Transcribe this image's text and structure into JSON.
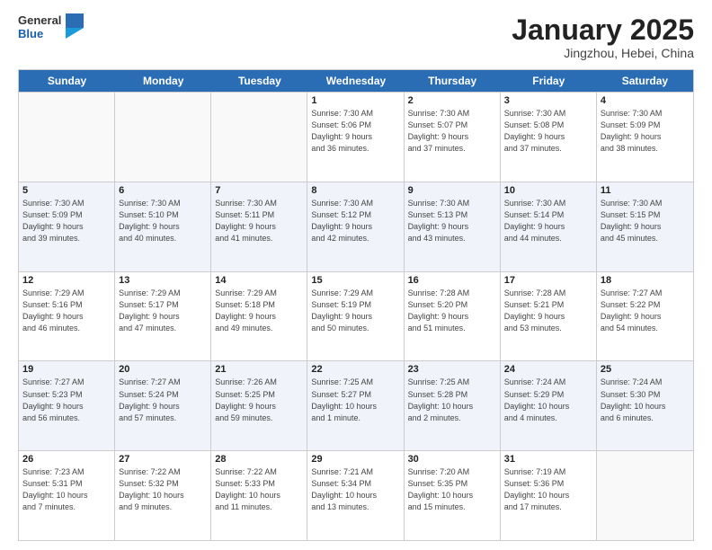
{
  "header": {
    "logo_general": "General",
    "logo_blue": "Blue",
    "month_year": "January 2025",
    "location": "Jingzhou, Hebei, China"
  },
  "days_of_week": [
    "Sunday",
    "Monday",
    "Tuesday",
    "Wednesday",
    "Thursday",
    "Friday",
    "Saturday"
  ],
  "weeks": [
    [
      {
        "day": "",
        "info": ""
      },
      {
        "day": "",
        "info": ""
      },
      {
        "day": "",
        "info": ""
      },
      {
        "day": "1",
        "info": "Sunrise: 7:30 AM\nSunset: 5:06 PM\nDaylight: 9 hours\nand 36 minutes."
      },
      {
        "day": "2",
        "info": "Sunrise: 7:30 AM\nSunset: 5:07 PM\nDaylight: 9 hours\nand 37 minutes."
      },
      {
        "day": "3",
        "info": "Sunrise: 7:30 AM\nSunset: 5:08 PM\nDaylight: 9 hours\nand 37 minutes."
      },
      {
        "day": "4",
        "info": "Sunrise: 7:30 AM\nSunset: 5:09 PM\nDaylight: 9 hours\nand 38 minutes."
      }
    ],
    [
      {
        "day": "5",
        "info": "Sunrise: 7:30 AM\nSunset: 5:09 PM\nDaylight: 9 hours\nand 39 minutes."
      },
      {
        "day": "6",
        "info": "Sunrise: 7:30 AM\nSunset: 5:10 PM\nDaylight: 9 hours\nand 40 minutes."
      },
      {
        "day": "7",
        "info": "Sunrise: 7:30 AM\nSunset: 5:11 PM\nDaylight: 9 hours\nand 41 minutes."
      },
      {
        "day": "8",
        "info": "Sunrise: 7:30 AM\nSunset: 5:12 PM\nDaylight: 9 hours\nand 42 minutes."
      },
      {
        "day": "9",
        "info": "Sunrise: 7:30 AM\nSunset: 5:13 PM\nDaylight: 9 hours\nand 43 minutes."
      },
      {
        "day": "10",
        "info": "Sunrise: 7:30 AM\nSunset: 5:14 PM\nDaylight: 9 hours\nand 44 minutes."
      },
      {
        "day": "11",
        "info": "Sunrise: 7:30 AM\nSunset: 5:15 PM\nDaylight: 9 hours\nand 45 minutes."
      }
    ],
    [
      {
        "day": "12",
        "info": "Sunrise: 7:29 AM\nSunset: 5:16 PM\nDaylight: 9 hours\nand 46 minutes."
      },
      {
        "day": "13",
        "info": "Sunrise: 7:29 AM\nSunset: 5:17 PM\nDaylight: 9 hours\nand 47 minutes."
      },
      {
        "day": "14",
        "info": "Sunrise: 7:29 AM\nSunset: 5:18 PM\nDaylight: 9 hours\nand 49 minutes."
      },
      {
        "day": "15",
        "info": "Sunrise: 7:29 AM\nSunset: 5:19 PM\nDaylight: 9 hours\nand 50 minutes."
      },
      {
        "day": "16",
        "info": "Sunrise: 7:28 AM\nSunset: 5:20 PM\nDaylight: 9 hours\nand 51 minutes."
      },
      {
        "day": "17",
        "info": "Sunrise: 7:28 AM\nSunset: 5:21 PM\nDaylight: 9 hours\nand 53 minutes."
      },
      {
        "day": "18",
        "info": "Sunrise: 7:27 AM\nSunset: 5:22 PM\nDaylight: 9 hours\nand 54 minutes."
      }
    ],
    [
      {
        "day": "19",
        "info": "Sunrise: 7:27 AM\nSunset: 5:23 PM\nDaylight: 9 hours\nand 56 minutes."
      },
      {
        "day": "20",
        "info": "Sunrise: 7:27 AM\nSunset: 5:24 PM\nDaylight: 9 hours\nand 57 minutes."
      },
      {
        "day": "21",
        "info": "Sunrise: 7:26 AM\nSunset: 5:25 PM\nDaylight: 9 hours\nand 59 minutes."
      },
      {
        "day": "22",
        "info": "Sunrise: 7:25 AM\nSunset: 5:27 PM\nDaylight: 10 hours\nand 1 minute."
      },
      {
        "day": "23",
        "info": "Sunrise: 7:25 AM\nSunset: 5:28 PM\nDaylight: 10 hours\nand 2 minutes."
      },
      {
        "day": "24",
        "info": "Sunrise: 7:24 AM\nSunset: 5:29 PM\nDaylight: 10 hours\nand 4 minutes."
      },
      {
        "day": "25",
        "info": "Sunrise: 7:24 AM\nSunset: 5:30 PM\nDaylight: 10 hours\nand 6 minutes."
      }
    ],
    [
      {
        "day": "26",
        "info": "Sunrise: 7:23 AM\nSunset: 5:31 PM\nDaylight: 10 hours\nand 7 minutes."
      },
      {
        "day": "27",
        "info": "Sunrise: 7:22 AM\nSunset: 5:32 PM\nDaylight: 10 hours\nand 9 minutes."
      },
      {
        "day": "28",
        "info": "Sunrise: 7:22 AM\nSunset: 5:33 PM\nDaylight: 10 hours\nand 11 minutes."
      },
      {
        "day": "29",
        "info": "Sunrise: 7:21 AM\nSunset: 5:34 PM\nDaylight: 10 hours\nand 13 minutes."
      },
      {
        "day": "30",
        "info": "Sunrise: 7:20 AM\nSunset: 5:35 PM\nDaylight: 10 hours\nand 15 minutes."
      },
      {
        "day": "31",
        "info": "Sunrise: 7:19 AM\nSunset: 5:36 PM\nDaylight: 10 hours\nand 17 minutes."
      },
      {
        "day": "",
        "info": ""
      }
    ]
  ]
}
